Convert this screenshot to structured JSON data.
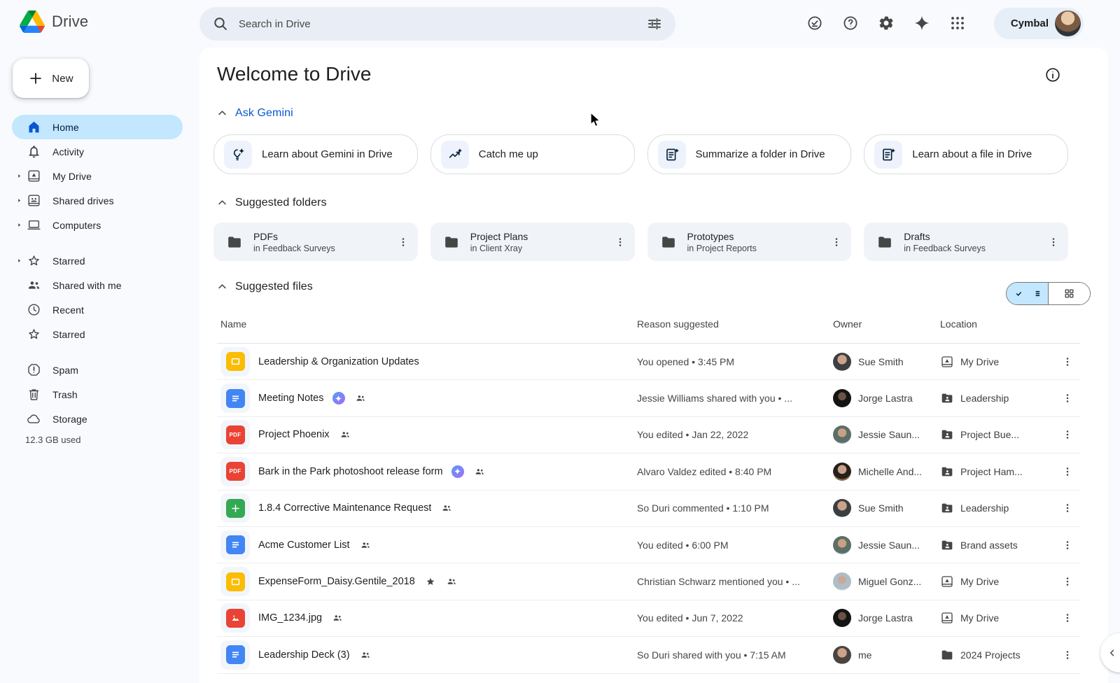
{
  "topbar": {
    "logo_text": "Drive",
    "search_placeholder": "Search in Drive",
    "brand": "Cymbal",
    "icons": [
      "availability-check",
      "help",
      "settings",
      "gemini-spark",
      "apps-grid"
    ]
  },
  "sidebar": {
    "new_label": "New",
    "items": [
      {
        "label": "Home",
        "icon": "home",
        "active": true,
        "expandable": false
      },
      {
        "label": "Activity",
        "icon": "bell",
        "active": false,
        "expandable": false
      },
      {
        "label": "My Drive",
        "icon": "mydrive",
        "active": false,
        "expandable": true
      },
      {
        "label": "Shared drives",
        "icon": "shareddrives",
        "active": false,
        "expandable": true
      },
      {
        "label": "Computers",
        "icon": "computer",
        "active": false,
        "expandable": true
      },
      {
        "gap": true
      },
      {
        "label": "Starred",
        "icon": "star",
        "active": false,
        "expandable": true
      },
      {
        "label": "Shared with me",
        "icon": "people",
        "active": false,
        "expandable": false
      },
      {
        "label": "Recent",
        "icon": "clock",
        "active": false,
        "expandable": false
      },
      {
        "label": "Starred",
        "icon": "star",
        "active": false,
        "expandable": false
      },
      {
        "gap": true
      },
      {
        "label": "Spam",
        "icon": "spam",
        "active": false,
        "expandable": false
      },
      {
        "label": "Trash",
        "icon": "trash",
        "active": false,
        "expandable": false
      },
      {
        "label": "Storage",
        "icon": "cloud",
        "active": false,
        "expandable": false
      }
    ],
    "storage_text": "12.3 GB used"
  },
  "main": {
    "title": "Welcome to Drive",
    "ask_gemini": {
      "label": "Ask Gemini",
      "cards": [
        {
          "label": "Learn about Gemini in Drive",
          "icon": "bulb-spark"
        },
        {
          "label": "Catch me up",
          "icon": "trend-spark"
        },
        {
          "label": "Summarize a folder in Drive",
          "icon": "doc-spark"
        },
        {
          "label": "Learn about a file in Drive",
          "icon": "doc-spark"
        }
      ]
    },
    "suggested_folders": {
      "label": "Suggested folders",
      "folders": [
        {
          "name": "PDFs",
          "location": "in Feedback Surveys"
        },
        {
          "name": "Project Plans",
          "location": "in Client Xray"
        },
        {
          "name": "Prototypes",
          "location": "in Project Reports"
        },
        {
          "name": "Drafts",
          "location": "in Feedback Surveys"
        }
      ]
    },
    "suggested_files": {
      "label": "Suggested files",
      "view_toggle": [
        "list-view-selected",
        "grid-view"
      ],
      "columns": [
        "Name",
        "Reason suggested",
        "Owner",
        "Location"
      ],
      "rows": [
        {
          "name": "Leadership & Organization Updates",
          "type": "slides",
          "badges": [],
          "reason": "You opened • 3:45 PM",
          "owner": "Sue Smith",
          "avatar": "sue",
          "location": "My Drive",
          "loc_icon": "mydrive"
        },
        {
          "name": "Meeting Notes",
          "type": "docs",
          "badges": [
            "gemini",
            "shared"
          ],
          "reason": "Jessie Williams shared with you • ...",
          "owner": "Jorge Lastra",
          "avatar": "jorge",
          "location": "Leadership",
          "loc_icon": "sharedfolder"
        },
        {
          "name": "Project Phoenix",
          "type": "pdf",
          "badges": [
            "shared"
          ],
          "reason": "You edited • Jan 22, 2022",
          "owner": "Jessie Saun...",
          "avatar": "jessie",
          "location": "Project Bue...",
          "loc_icon": "sharedfolder"
        },
        {
          "name": "Bark in the Park photoshoot release form",
          "type": "pdf",
          "badges": [
            "gemini",
            "shared"
          ],
          "reason": "Alvaro Valdez edited • 8:40 PM",
          "owner": "Michelle And...",
          "avatar": "michelle",
          "location": "Project Ham...",
          "loc_icon": "sharedfolder"
        },
        {
          "name": "1.8.4 Corrective Maintenance Request",
          "type": "sheets",
          "badges": [
            "shared"
          ],
          "reason": "So Duri commented • 1:10 PM",
          "owner": "Sue Smith",
          "avatar": "sue",
          "location": "Leadership",
          "loc_icon": "sharedfolder"
        },
        {
          "name": "Acme Customer List",
          "type": "docs",
          "badges": [
            "shared"
          ],
          "reason": "You edited • 6:00 PM",
          "owner": "Jessie Saun...",
          "avatar": "jessie",
          "location": "Brand assets",
          "loc_icon": "sharedfolder"
        },
        {
          "name": "ExpenseForm_Daisy.Gentile_2018",
          "type": "slides",
          "badges": [
            "star",
            "shared"
          ],
          "reason": "Christian Schwarz mentioned you • ...",
          "owner": "Miguel Gonz...",
          "avatar": "miguel",
          "location": "My Drive",
          "loc_icon": "mydrive"
        },
        {
          "name": "IMG_1234.jpg",
          "type": "image",
          "badges": [
            "shared"
          ],
          "reason": "You edited • Jun 7, 2022",
          "owner": "Jorge Lastra",
          "avatar": "jorge",
          "location": "My Drive",
          "loc_icon": "mydrive"
        },
        {
          "name": "Leadership Deck (3)",
          "type": "docs",
          "badges": [
            "shared"
          ],
          "reason": "So Duri shared with you • 7:15 AM",
          "owner": "me",
          "avatar": "me",
          "location": "2024 Projects",
          "loc_icon": "folder"
        }
      ]
    }
  },
  "colors": {
    "page_bg": "#F8FAFD",
    "accent_blue": "#0B57D0",
    "active_pill": "#C2E7FF",
    "docs": "#4285F4",
    "slides": "#FBBC04",
    "pdf": "#EA4335",
    "sheets": "#34A853",
    "image": "#EA4335",
    "folder_card_bg": "#F0F4F9"
  }
}
